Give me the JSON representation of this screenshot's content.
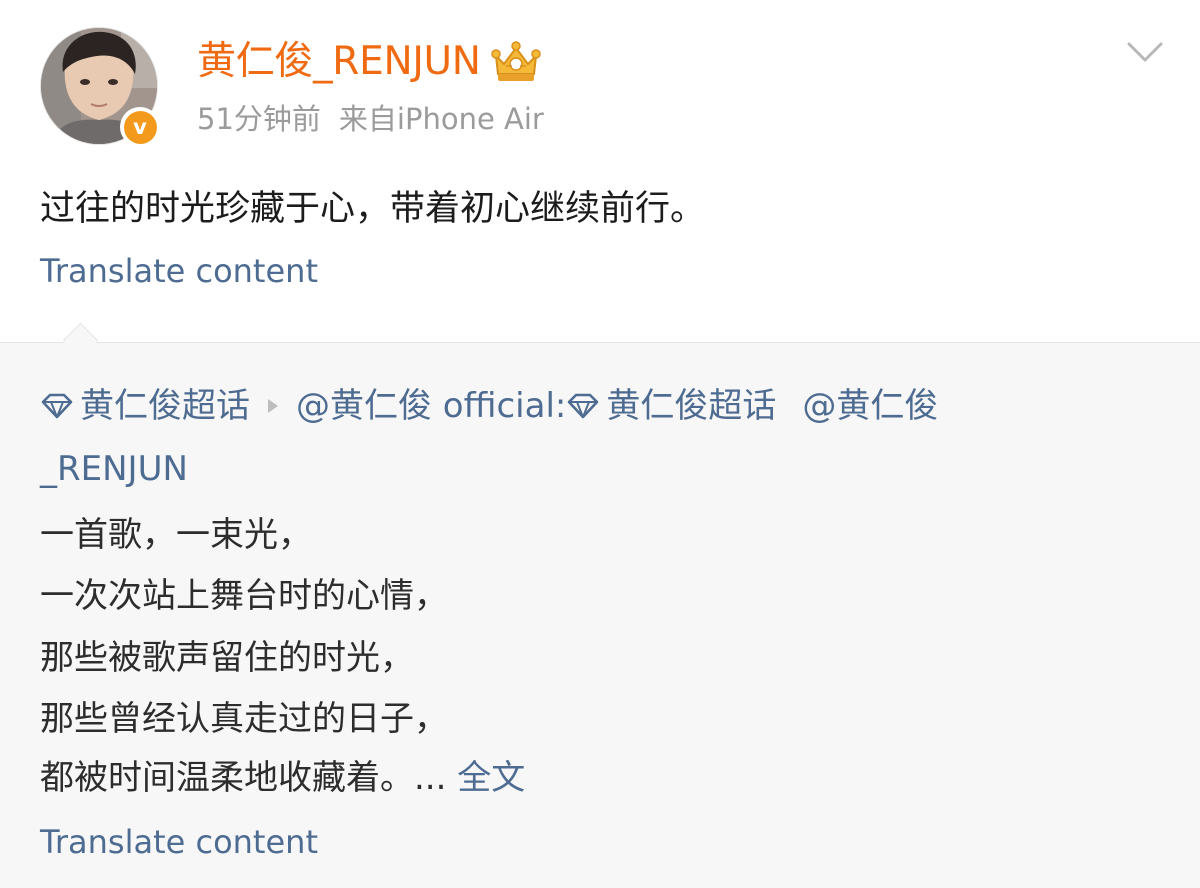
{
  "post": {
    "username": "黄仁俊_RENJUN",
    "time": "51分钟前",
    "source": "来自iPhone Air",
    "verified_badge": "v",
    "text": "过往的时光珍藏于心，带着初心继续前行。",
    "translate_label": "Translate content",
    "icons": [
      "crown-icon",
      "chevron-down-icon",
      "verified-icon"
    ]
  },
  "repost": {
    "topic_1": "黄仁俊超话",
    "mention_author": "@黄仁俊 official:",
    "topic_2": "黄仁俊超话",
    "mention_1": "@黄仁俊",
    "mention_1_cont": "_RENJUN",
    "lines": [
      "一首歌，一束光，",
      "一次次站上舞台时的心情，",
      "那些被歌声留住的时光，",
      "那些曾经认真走过的日子，",
      "都被时间温柔地收藏着。..."
    ],
    "full_text_link": "全文",
    "translate_label": "Translate content",
    "icons": [
      "gem-icon",
      "play-icon"
    ]
  },
  "colors": {
    "username": "#f06a11",
    "link": "#4e6c92",
    "meta": "#9b9b9b",
    "badge": "#f39a1c",
    "repost_bg": "#f7f7f7"
  }
}
